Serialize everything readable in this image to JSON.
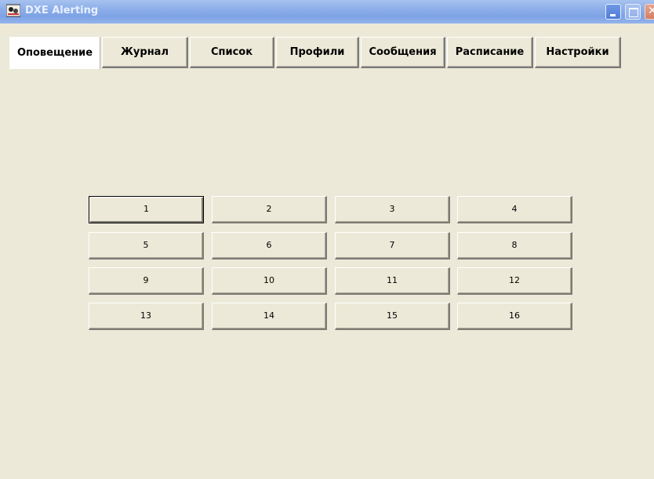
{
  "window": {
    "title": "DXE Alerting",
    "app_icon": "dxe-app-icon",
    "controls": {
      "minimize": "minimize-icon",
      "maximize": "maximize-icon",
      "close": "close-icon"
    },
    "colors": {
      "background": "#ece9d8",
      "titlebar": "#8fb0ea",
      "close": "#d47e66"
    }
  },
  "tabs": [
    {
      "label": "Оповещение",
      "active": true
    },
    {
      "label": "Журнал",
      "active": false
    },
    {
      "label": "Список",
      "active": false
    },
    {
      "label": "Профили",
      "active": false
    },
    {
      "label": "Сообщения",
      "active": false
    },
    {
      "label": "Расписание",
      "active": false
    },
    {
      "label": "Настройки",
      "active": false
    }
  ],
  "alert_buttons": [
    {
      "label": "1"
    },
    {
      "label": "2"
    },
    {
      "label": "3"
    },
    {
      "label": "4"
    },
    {
      "label": "5"
    },
    {
      "label": "6"
    },
    {
      "label": "7"
    },
    {
      "label": "8"
    },
    {
      "label": "9"
    },
    {
      "label": "10"
    },
    {
      "label": "11"
    },
    {
      "label": "12"
    },
    {
      "label": "13"
    },
    {
      "label": "14"
    },
    {
      "label": "15"
    },
    {
      "label": "16"
    }
  ],
  "focused_button": "1"
}
